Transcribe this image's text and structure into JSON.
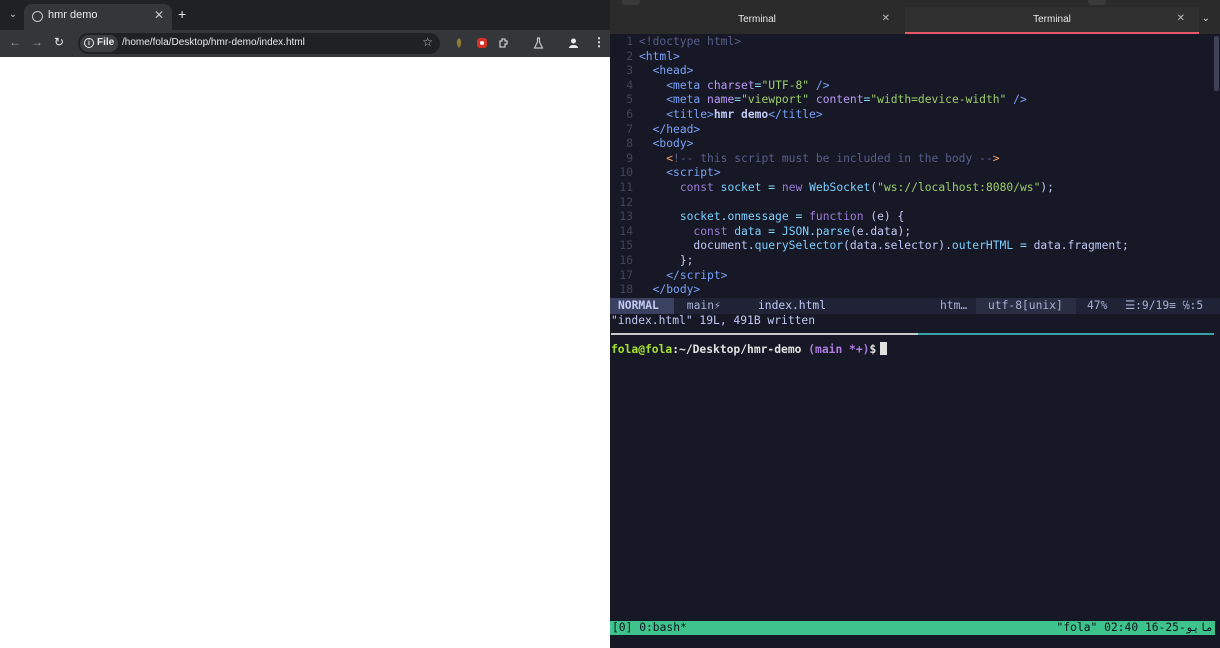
{
  "browser": {
    "tab_title": "hmr demo",
    "new_tab": "+",
    "chip_label": "File",
    "url": "/home/fola/Desktop/hmr-demo/index.html"
  },
  "terminal": {
    "tabs": [
      {
        "label": "Terminal",
        "active": false
      },
      {
        "label": "Terminal",
        "active": true
      }
    ]
  },
  "editor": {
    "lines": [
      {
        "n": "1",
        "html": "<span class=\"cm\">&lt;!doctype html&gt;</span>"
      },
      {
        "n": "2",
        "html": "<span class=\"tg\">&lt;html&gt;</span>"
      },
      {
        "n": "3",
        "html": "  <span class=\"tg\">&lt;head&gt;</span>"
      },
      {
        "n": "4",
        "html": "    <span class=\"tg\">&lt;meta</span> <span class=\"at\">charset</span><span class=\"pu\">=</span><span class=\"st\">\"UTF-8\"</span> <span class=\"tg\">/&gt;</span>"
      },
      {
        "n": "5",
        "html": "    <span class=\"tg\">&lt;meta</span> <span class=\"at\">name</span><span class=\"pu\">=</span><span class=\"st\">\"viewport\"</span> <span class=\"at\">content</span><span class=\"pu\">=</span><span class=\"st\">\"width=device-width\"</span> <span class=\"tg\">/&gt;</span>"
      },
      {
        "n": "6",
        "html": "    <span class=\"tg\">&lt;title&gt;</span><span class=\"wh bold\">hmr demo</span><span class=\"tg\">&lt;/title&gt;</span>"
      },
      {
        "n": "7",
        "html": "  <span class=\"tg\">&lt;/head&gt;</span>"
      },
      {
        "n": "8",
        "html": "  <span class=\"tg\">&lt;body&gt;</span>"
      },
      {
        "n": "9",
        "html": "    <span class=\"or\">&lt;</span><span class=\"cm\">!-- this script must be included in the body --</span><span class=\"or\">&gt;</span>"
      },
      {
        "n": "10",
        "html": "    <span class=\"tg\">&lt;script&gt;</span>"
      },
      {
        "n": "11",
        "html": "      <span class=\"kw\">const</span> <span class=\"fn\">socket</span> <span class=\"pu\">=</span> <span class=\"kw\">new</span> <span class=\"fn\">WebSocket</span><span class=\"wh\">(</span><span class=\"st\">\"ws://localhost:8080/ws\"</span><span class=\"wh\">);</span>"
      },
      {
        "n": "12",
        "html": ""
      },
      {
        "n": "13",
        "html": "      <span class=\"fn\">socket</span><span class=\"pu\">.</span><span class=\"fn\">onmessage</span> <span class=\"pu\">=</span> <span class=\"kw\">function</span> <span class=\"wh\">(e) {</span>"
      },
      {
        "n": "14",
        "html": "        <span class=\"kw\">const</span> <span class=\"fn\">data</span> <span class=\"pu\">=</span> <span class=\"fn\">JSON</span><span class=\"pu\">.</span><span class=\"fn\">parse</span><span class=\"wh\">(e.data);</span>"
      },
      {
        "n": "15",
        "html": "        <span class=\"wh\">document</span><span class=\"pu\">.</span><span class=\"fn\">querySelector</span><span class=\"wh\">(data.selector).</span><span class=\"fn\">outerHTML</span> <span class=\"pu\">=</span> <span class=\"wh\">data.fragment;</span>"
      },
      {
        "n": "16",
        "html": "      <span class=\"wh\">};</span>"
      },
      {
        "n": "17",
        "html": "    <span class=\"tg\">&lt;/script&gt;</span>"
      },
      {
        "n": "18",
        "html": "  <span class=\"tg\">&lt;/body&gt;</span>"
      }
    ]
  },
  "statusline": {
    "mode": "NORMAL",
    "branch": " main⚡",
    "file": "index.html",
    "filetype": "htm…",
    "encoding": "utf-8[unix]",
    "percent": "47%",
    "position": "☰:9/19≡ ℅:5"
  },
  "message": "\"index.html\" 19L, 491B written",
  "shell": {
    "user": "fola@fola",
    "path": ":~/Desktop/hmr-demo",
    "git": " (main *+)",
    "dollar": "$"
  },
  "tmux": {
    "left": "[0] 0:bash*",
    "right": "\"fola\" 02:40 16-25-مايو"
  },
  "colors": {
    "accent_tab_underline": "#e5596a",
    "tmux_bar": "#3ec38d",
    "pane_divider": "#3aa2a4"
  }
}
